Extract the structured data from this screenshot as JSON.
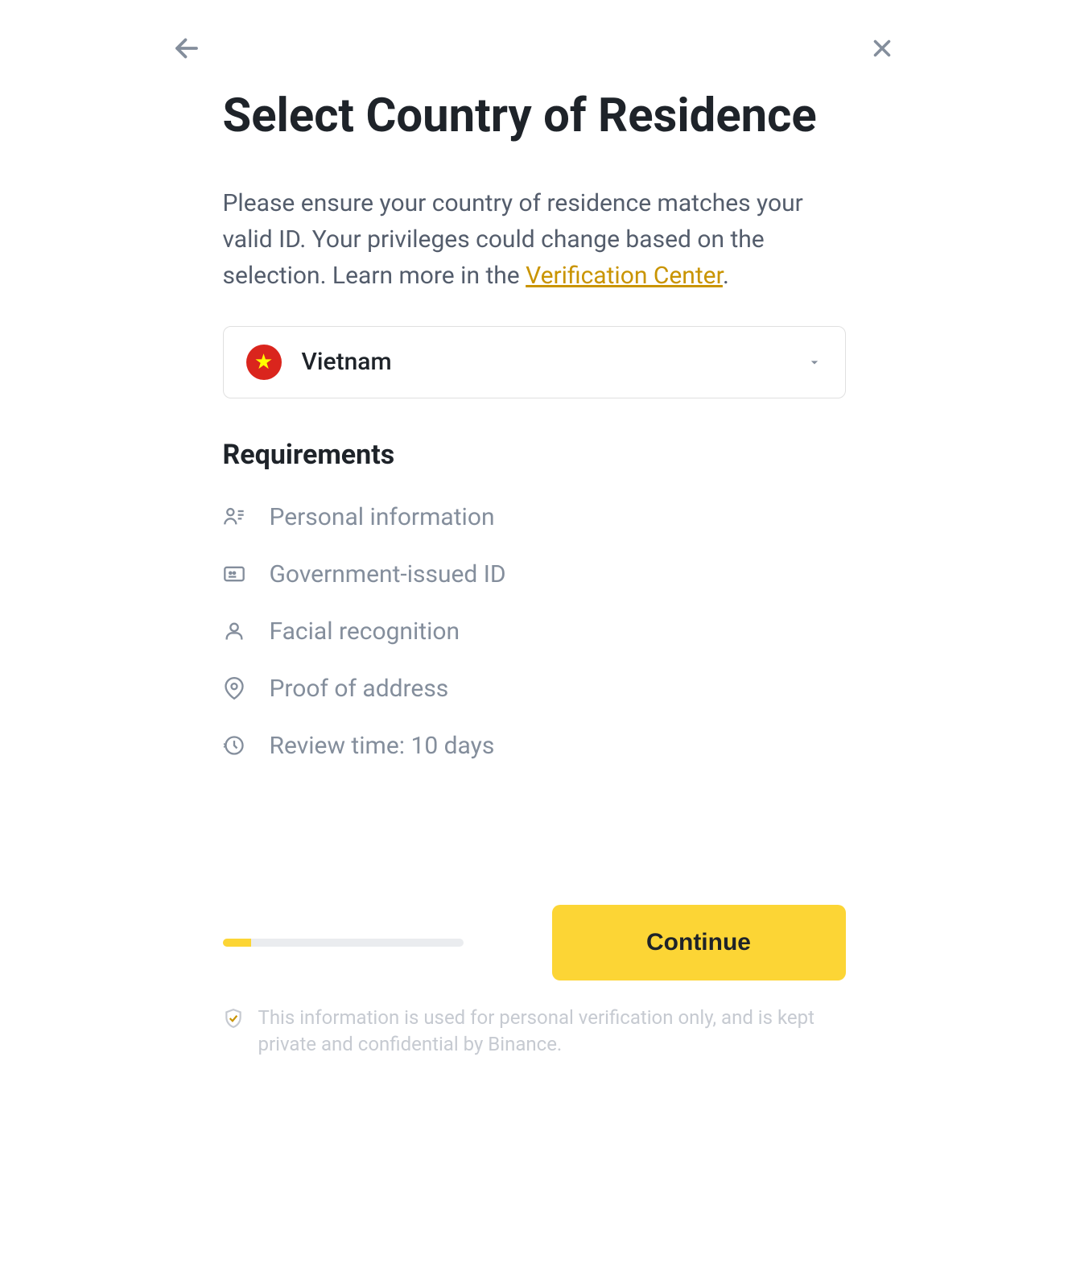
{
  "header": {
    "title": "Select Country of Residence"
  },
  "description": {
    "text_before": "Please ensure your country of residence matches your valid ID. Your privileges could change based on the selection. Learn more in the ",
    "link_text": "Verification Center",
    "text_after": "."
  },
  "country_select": {
    "selected": "Vietnam"
  },
  "requirements": {
    "title": "Requirements",
    "items": [
      {
        "icon": "personal-info-icon",
        "label": "Personal information"
      },
      {
        "icon": "id-card-icon",
        "label": "Government-issued ID"
      },
      {
        "icon": "face-icon",
        "label": "Facial recognition"
      },
      {
        "icon": "location-icon",
        "label": "Proof of address"
      },
      {
        "icon": "clock-icon",
        "label": "Review time: 10 days"
      }
    ]
  },
  "footer": {
    "continue_label": "Continue",
    "progress_percent": 12
  },
  "disclaimer": {
    "text": "This information is used for personal verification only, and is kept private and confidential by Binance."
  }
}
